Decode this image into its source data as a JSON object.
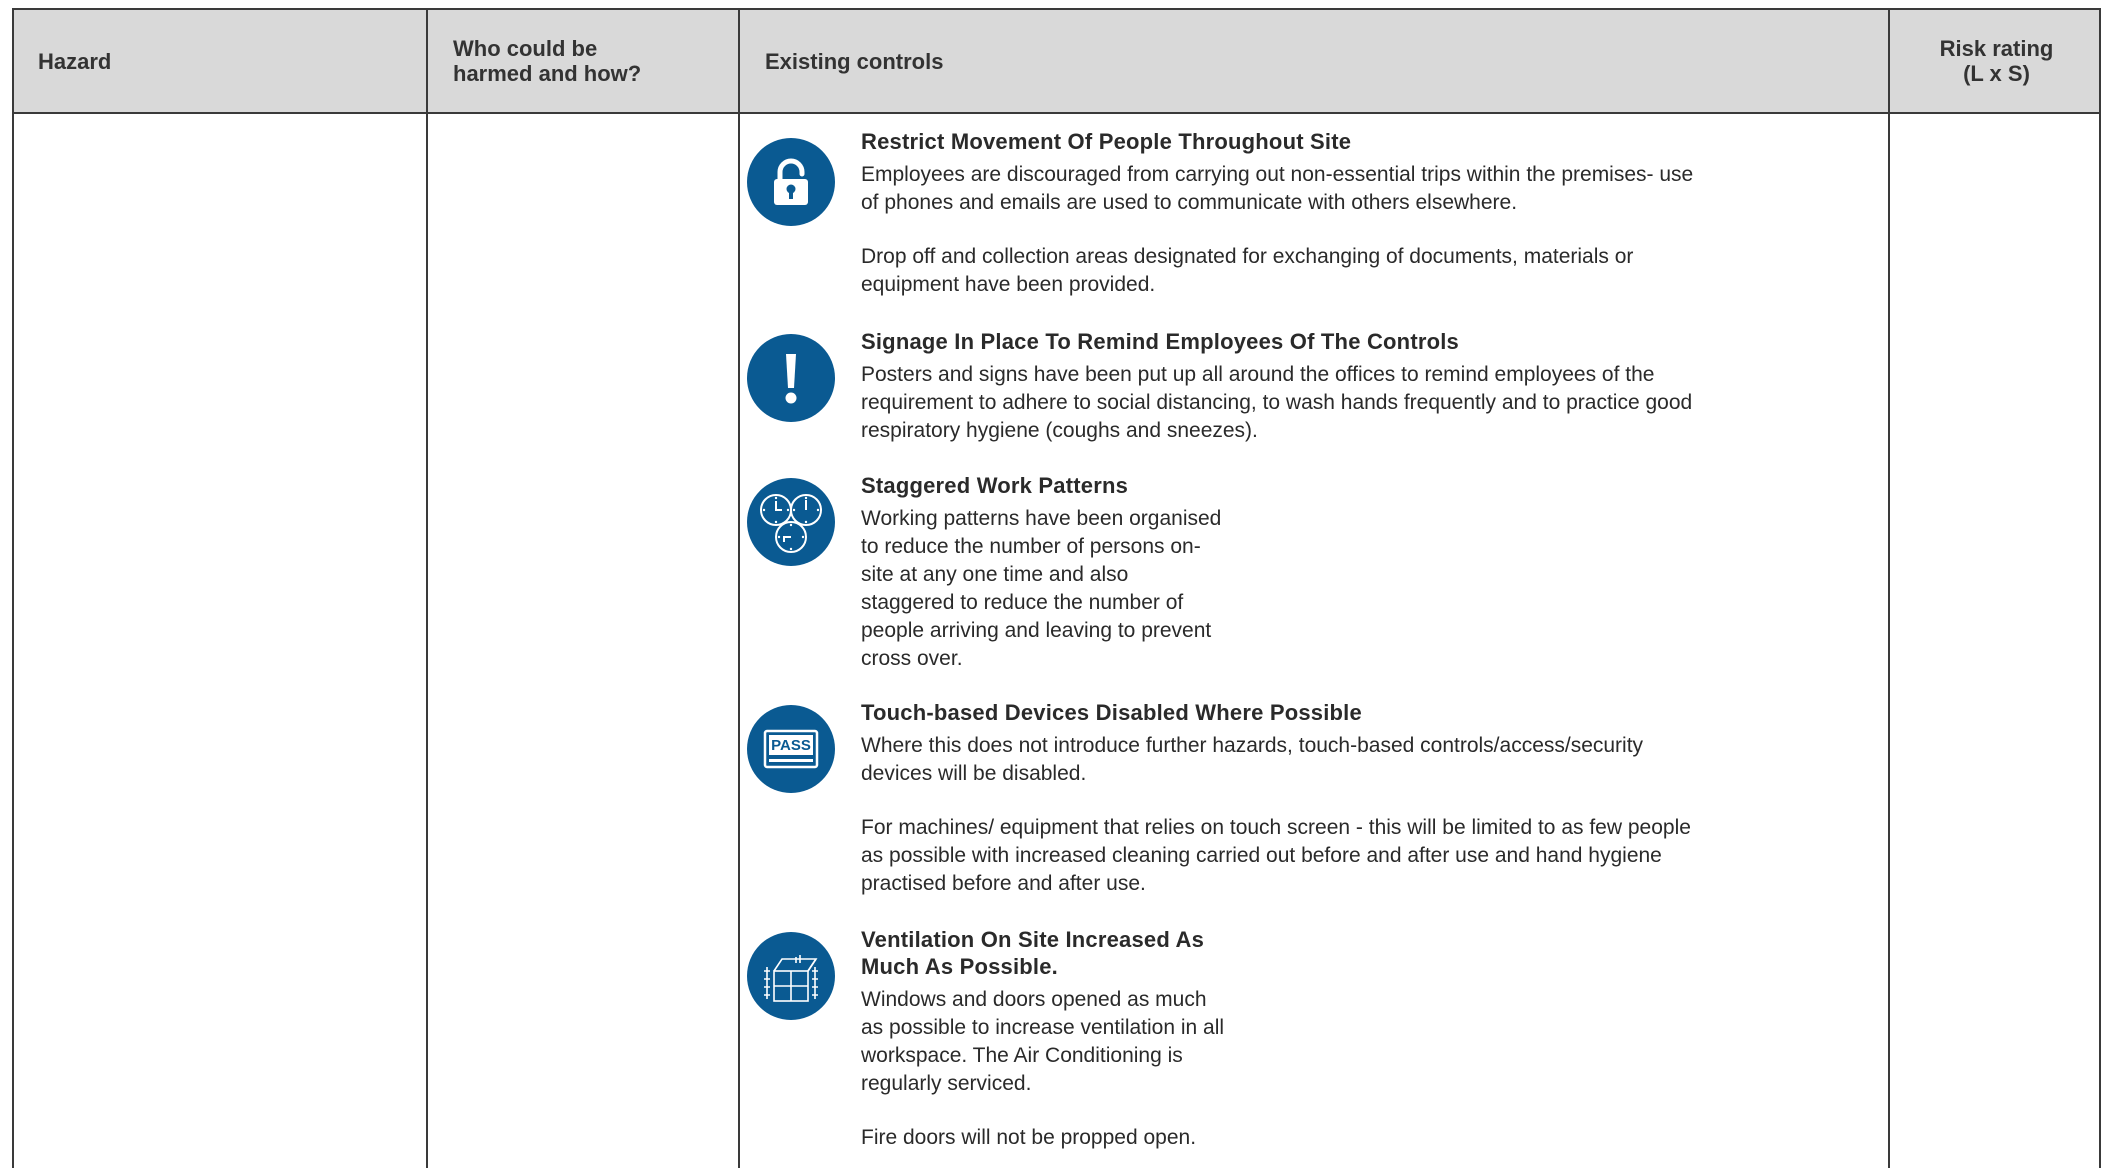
{
  "table": {
    "headers": {
      "hazard": "Hazard",
      "who": [
        "Who could be",
        "harmed and how?"
      ],
      "controls": "Existing controls",
      "risk": [
        "Risk rating",
        "(L x S)"
      ]
    },
    "controls": [
      {
        "icon": "padlock-icon",
        "title": "Restrict Movement Of People Throughout Site",
        "paragraphs": [
          [
            "Employees are discouraged from carrying out non-essential trips within the premises- use",
            "of phones and emails are used to communicate with others elsewhere."
          ],
          [
            "Drop off and collection areas designated for exchanging of documents, materials or",
            "equipment have been provided."
          ]
        ]
      },
      {
        "icon": "exclamation-icon",
        "title": "Signage In Place To Remind Employees Of The Controls",
        "paragraphs": [
          [
            "Posters and signs have been put up all around the offices to remind employees of the",
            "requirement to adhere to social distancing, to wash hands frequently and to practice good",
            "respiratory hygiene (coughs and sneezes)."
          ]
        ]
      },
      {
        "icon": "clocks-icon",
        "title": "Staggered Work Patterns",
        "paragraphs": [
          [
            "Working patterns have been organised",
            "to reduce the number of persons on-",
            "site at any one time and also",
            "staggered to reduce the number of",
            "people arriving and leaving to prevent",
            "cross over."
          ]
        ]
      },
      {
        "icon": "pass-card-icon",
        "icon_text": "PASS",
        "title": "Touch-based Devices Disabled Where Possible",
        "paragraphs": [
          [
            "Where this does not introduce further hazards, touch-based controls/access/security",
            "devices will be disabled."
          ],
          [
            "For machines/ equipment that relies on touch screen - this will be limited to as few people",
            "as possible with increased cleaning carried out before and after use and hand hygiene",
            "practised before and after use."
          ]
        ]
      },
      {
        "icon": "open-window-icon",
        "title": [
          "Ventilation On Site Increased As",
          "Much As Possible."
        ],
        "paragraphs": [
          [
            "Windows and doors opened as much",
            "as possible to increase ventilation in all",
            "workspace. The Air Conditioning is",
            "regularly serviced."
          ],
          [
            "Fire doors will not be propped open."
          ]
        ]
      }
    ]
  },
  "colors": {
    "header_bg": "#d9d9d9",
    "icon_bg": "#0a5a92",
    "border": "#3a3a3a"
  }
}
